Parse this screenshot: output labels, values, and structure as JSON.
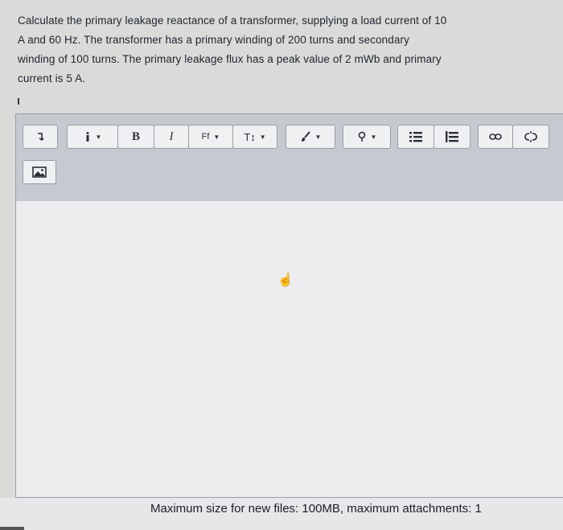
{
  "question": {
    "lines": [
      "Calculate the primary leakage reactance of a transformer, supplying a load current of 10",
      "A and 60 Hz. The transformer has a primary winding of 200 turns and secondary",
      "winding of 100 turns. The primary leakage flux has a peak value of 2 mWb and primary",
      "current is 5 A."
    ]
  },
  "toolbar": {
    "collapse_icon": "collapse-icon",
    "info_icon": "info-icon",
    "bold_label": "B",
    "italic_label": "I",
    "font_family_label": "Ff",
    "font_size_label": "T↕",
    "text_color_icon": "brush-icon",
    "highlight_icon": "marker-icon",
    "bullet_list_icon": "bullet-list-icon",
    "numbered_list_icon": "numbered-list-icon",
    "link_icon": "link-icon",
    "unlink_icon": "unlink-icon",
    "image_icon": "image-icon"
  },
  "footer": {
    "text": "Maximum size for new files: 100MB, maximum attachments: 1"
  }
}
